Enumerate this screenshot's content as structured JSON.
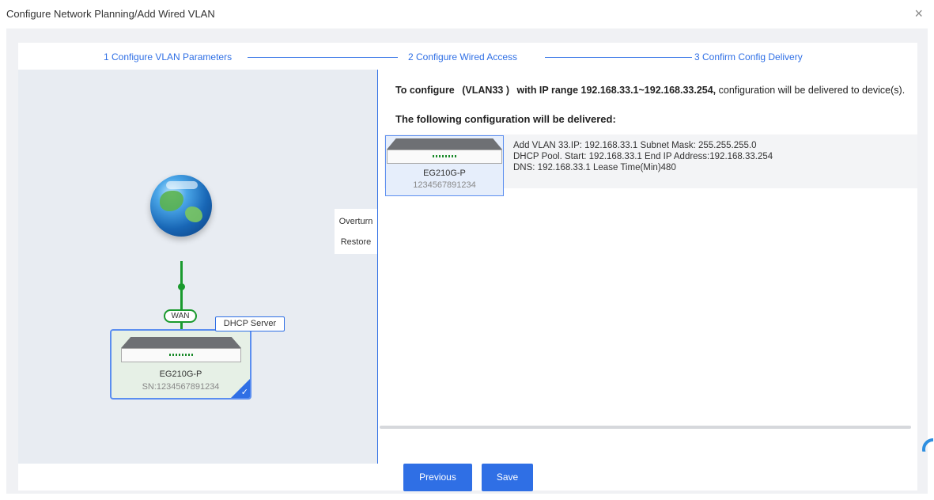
{
  "dialog": {
    "title": "Configure Network Planning/Add Wired VLAN",
    "close_label": "×"
  },
  "steps": [
    {
      "label": "1 Configure VLAN Parameters"
    },
    {
      "label": "2 Configure Wired Access"
    },
    {
      "label": "3 Confirm Config Delivery"
    }
  ],
  "topology": {
    "wan_label": "WAN",
    "dhcp_label": "DHCP Server",
    "device": {
      "model": "EG210G-P",
      "sn": "SN:1234567891234"
    },
    "side_buttons": {
      "overturn": "Overturn",
      "restore": "Restore"
    },
    "link_color": "#1a9a2e"
  },
  "config": {
    "intro_prefix": "To configure",
    "intro_vlan": "(VLAN33 )",
    "intro_mid": "with IP range 192.168.33.1~192.168.33.254,",
    "intro_suffix": "configuration will be delivered to device(s).",
    "heading": "The following configuration will be delivered:",
    "device": {
      "model": "EG210G-P",
      "sn": "1234567891234"
    },
    "lines": [
      "Add VLAN 33.IP: 192.168.33.1 Subnet Mask: 255.255.255.0",
      "DHCP Pool. Start: 192.168.33.1 End IP Address:192.168.33.254",
      "DNS: 192.168.33.1 Lease Time(Min)480"
    ]
  },
  "footer": {
    "previous_label": "Previous",
    "save_label": "Save"
  },
  "colors": {
    "accent": "#2f6fe5",
    "topology_bg": "#e8ecf2"
  }
}
